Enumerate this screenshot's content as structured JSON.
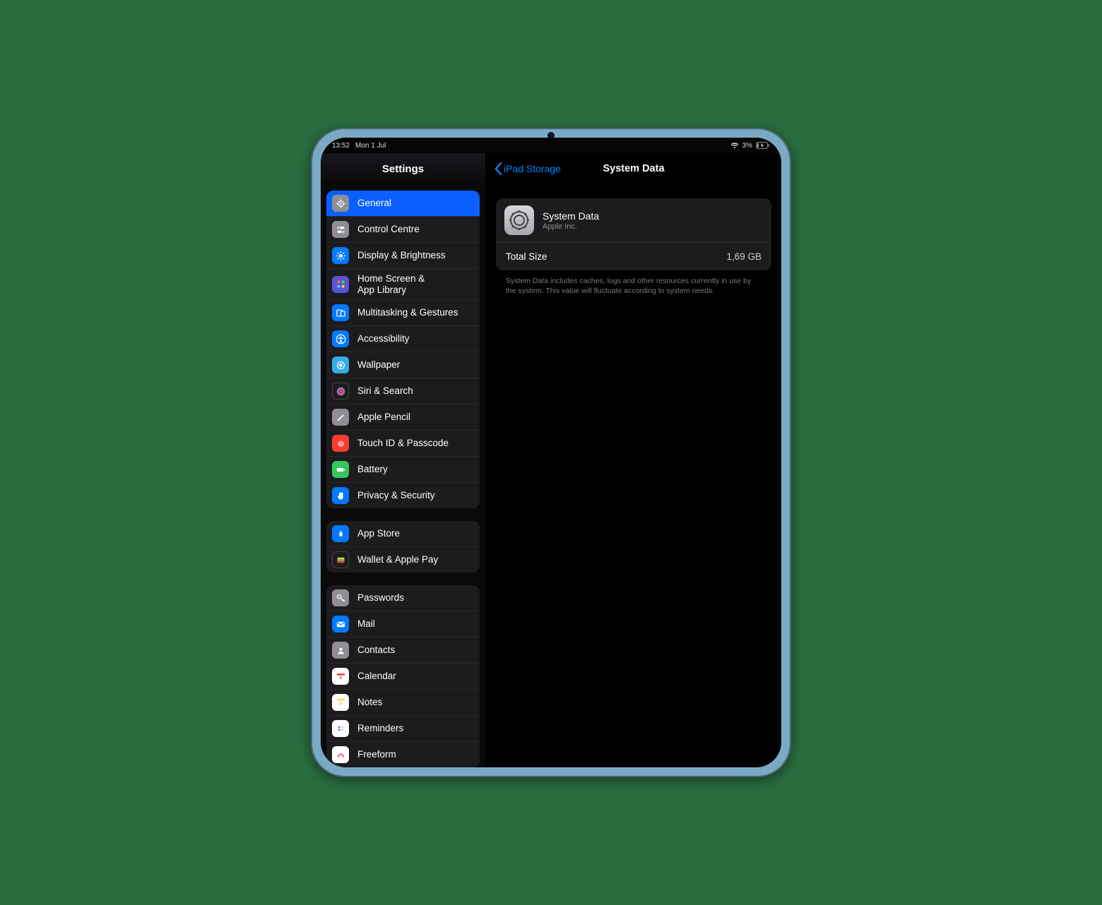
{
  "status": {
    "time": "13:52",
    "date": "Mon 1 Jul",
    "battery_pct": "3%"
  },
  "sidebar": {
    "title": "Settings",
    "groups": [
      {
        "items": [
          {
            "label": "General",
            "icon": "gear-icon",
            "bg": "bg-grey",
            "selected": true
          },
          {
            "label": "Control Centre",
            "icon": "switches-icon",
            "bg": "bg-grey"
          },
          {
            "label": "Display & Brightness",
            "icon": "brightness-icon",
            "bg": "bg-blue"
          },
          {
            "label": "Home Screen &\nApp Library",
            "icon": "grid-icon",
            "bg": "bg-purple"
          },
          {
            "label": "Multitasking & Gestures",
            "icon": "multitask-icon",
            "bg": "bg-blue"
          },
          {
            "label": "Accessibility",
            "icon": "accessibility-icon",
            "bg": "bg-blue"
          },
          {
            "label": "Wallpaper",
            "icon": "wallpaper-icon",
            "bg": "bg-cyan"
          },
          {
            "label": "Siri & Search",
            "icon": "siri-icon",
            "bg": "bg-black"
          },
          {
            "label": "Apple Pencil",
            "icon": "pencil-icon",
            "bg": "bg-grey"
          },
          {
            "label": "Touch ID & Passcode",
            "icon": "touchid-icon",
            "bg": "bg-red"
          },
          {
            "label": "Battery",
            "icon": "battery-icon",
            "bg": "bg-green"
          },
          {
            "label": "Privacy & Security",
            "icon": "hand-icon",
            "bg": "bg-blue"
          }
        ]
      },
      {
        "items": [
          {
            "label": "App Store",
            "icon": "appstore-icon",
            "bg": "bg-blue"
          },
          {
            "label": "Wallet & Apple Pay",
            "icon": "wallet-icon",
            "bg": "bg-black"
          }
        ]
      },
      {
        "items": [
          {
            "label": "Passwords",
            "icon": "key-icon",
            "bg": "bg-grey"
          },
          {
            "label": "Mail",
            "icon": "mail-icon",
            "bg": "bg-blue"
          },
          {
            "label": "Contacts",
            "icon": "contacts-icon",
            "bg": "bg-grey"
          },
          {
            "label": "Calendar",
            "icon": "calendar-icon",
            "bg": "bg-white"
          },
          {
            "label": "Notes",
            "icon": "notes-icon",
            "bg": "bg-white"
          },
          {
            "label": "Reminders",
            "icon": "reminders-icon",
            "bg": "bg-white"
          },
          {
            "label": "Freeform",
            "icon": "freeform-icon",
            "bg": "bg-white"
          }
        ]
      }
    ]
  },
  "detail": {
    "back_label": "iPad Storage",
    "title": "System Data",
    "app": {
      "name": "System Data",
      "vendor": "Apple Inc."
    },
    "size_row": {
      "label": "Total Size",
      "value": "1,69 GB"
    },
    "footer": "System Data includes caches, logs and other resources currently in use by the system. This value will fluctuate according to system needs."
  }
}
